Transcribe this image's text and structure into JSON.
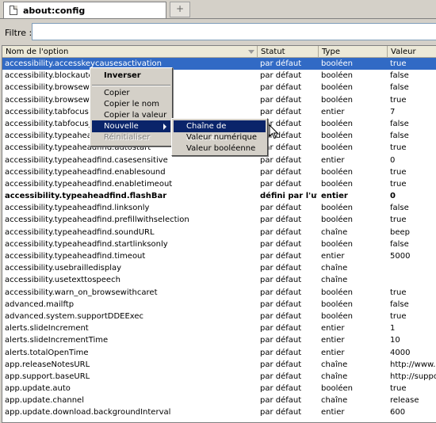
{
  "tab": {
    "title": "about:config",
    "new_tab_glyph": "+"
  },
  "filter": {
    "label": "Filtre :",
    "value": ""
  },
  "columns": [
    "Nom de l'option",
    "Statut",
    "Type",
    "Valeur"
  ],
  "rows": [
    [
      "accessibility.accesskeycausesactivation",
      "par défaut",
      "booléen",
      "true"
    ],
    [
      "accessibility.blockautorefre",
      "par défaut",
      "booléen",
      "false"
    ],
    [
      "accessibility.browsewithca",
      "par défaut",
      "booléen",
      "false"
    ],
    [
      "accessibility.browsewithca",
      "par défaut",
      "booléen",
      "true"
    ],
    [
      "accessibility.tabfocus",
      "par défaut",
      "entier",
      "7"
    ],
    [
      "accessibility.tabfocus_app",
      "par défaut",
      "booléen",
      "false"
    ],
    [
      "accessibility.typeaheadfin",
      "par défaut",
      "booléen",
      "false"
    ],
    [
      "accessibility.typeaheadfind.autostart",
      "par défaut",
      "booléen",
      "true"
    ],
    [
      "accessibility.typeaheadfind.casesensitive",
      "par défaut",
      "entier",
      "0"
    ],
    [
      "accessibility.typeaheadfind.enablesound",
      "par défaut",
      "booléen",
      "true"
    ],
    [
      "accessibility.typeaheadfind.enabletimeout",
      "par défaut",
      "booléen",
      "true"
    ],
    [
      "accessibility.typeaheadfind.flashBar",
      "défini par l'uti...",
      "entier",
      "0"
    ],
    [
      "accessibility.typeaheadfind.linksonly",
      "par défaut",
      "booléen",
      "false"
    ],
    [
      "accessibility.typeaheadfind.prefillwithselection",
      "par défaut",
      "booléen",
      "true"
    ],
    [
      "accessibility.typeaheadfind.soundURL",
      "par défaut",
      "chaîne",
      "beep"
    ],
    [
      "accessibility.typeaheadfind.startlinksonly",
      "par défaut",
      "booléen",
      "false"
    ],
    [
      "accessibility.typeaheadfind.timeout",
      "par défaut",
      "entier",
      "5000"
    ],
    [
      "accessibility.usebrailledisplay",
      "par défaut",
      "chaîne",
      ""
    ],
    [
      "accessibility.usetexttospeech",
      "par défaut",
      "chaîne",
      ""
    ],
    [
      "accessibility.warn_on_browsewithcaret",
      "par défaut",
      "booléen",
      "true"
    ],
    [
      "advanced.mailftp",
      "par défaut",
      "booléen",
      "false"
    ],
    [
      "advanced.system.supportDDEExec",
      "par défaut",
      "booléen",
      "true"
    ],
    [
      "alerts.slideIncrement",
      "par défaut",
      "entier",
      "1"
    ],
    [
      "alerts.slideIncrementTime",
      "par défaut",
      "entier",
      "10"
    ],
    [
      "alerts.totalOpenTime",
      "par défaut",
      "entier",
      "4000"
    ],
    [
      "app.releaseNotesURL",
      "par défaut",
      "chaîne",
      "http://www.mo"
    ],
    [
      "app.support.baseURL",
      "par défaut",
      "chaîne",
      "http://support"
    ],
    [
      "app.update.auto",
      "par défaut",
      "booléen",
      "true"
    ],
    [
      "app.update.channel",
      "par défaut",
      "chaîne",
      "release"
    ],
    [
      "app.update.download.backgroundInterval",
      "par défaut",
      "entier",
      "600"
    ]
  ],
  "selected_row": 0,
  "bold_row": 11,
  "context_menu": {
    "toggle": "Inverser",
    "copy": "Copier",
    "copy_name": "Copier le nom",
    "copy_value": "Copier la valeur",
    "new": "Nouvelle",
    "reset": "Réinitialiser"
  },
  "submenu": {
    "string": "Chaîne de caractères",
    "integer": "Valeur numérique",
    "boolean": "Valeur booléenne"
  },
  "colors": {
    "selection": "#316ac5",
    "menu_highlight": "#0a246a",
    "chrome": "#d4d0c8"
  }
}
